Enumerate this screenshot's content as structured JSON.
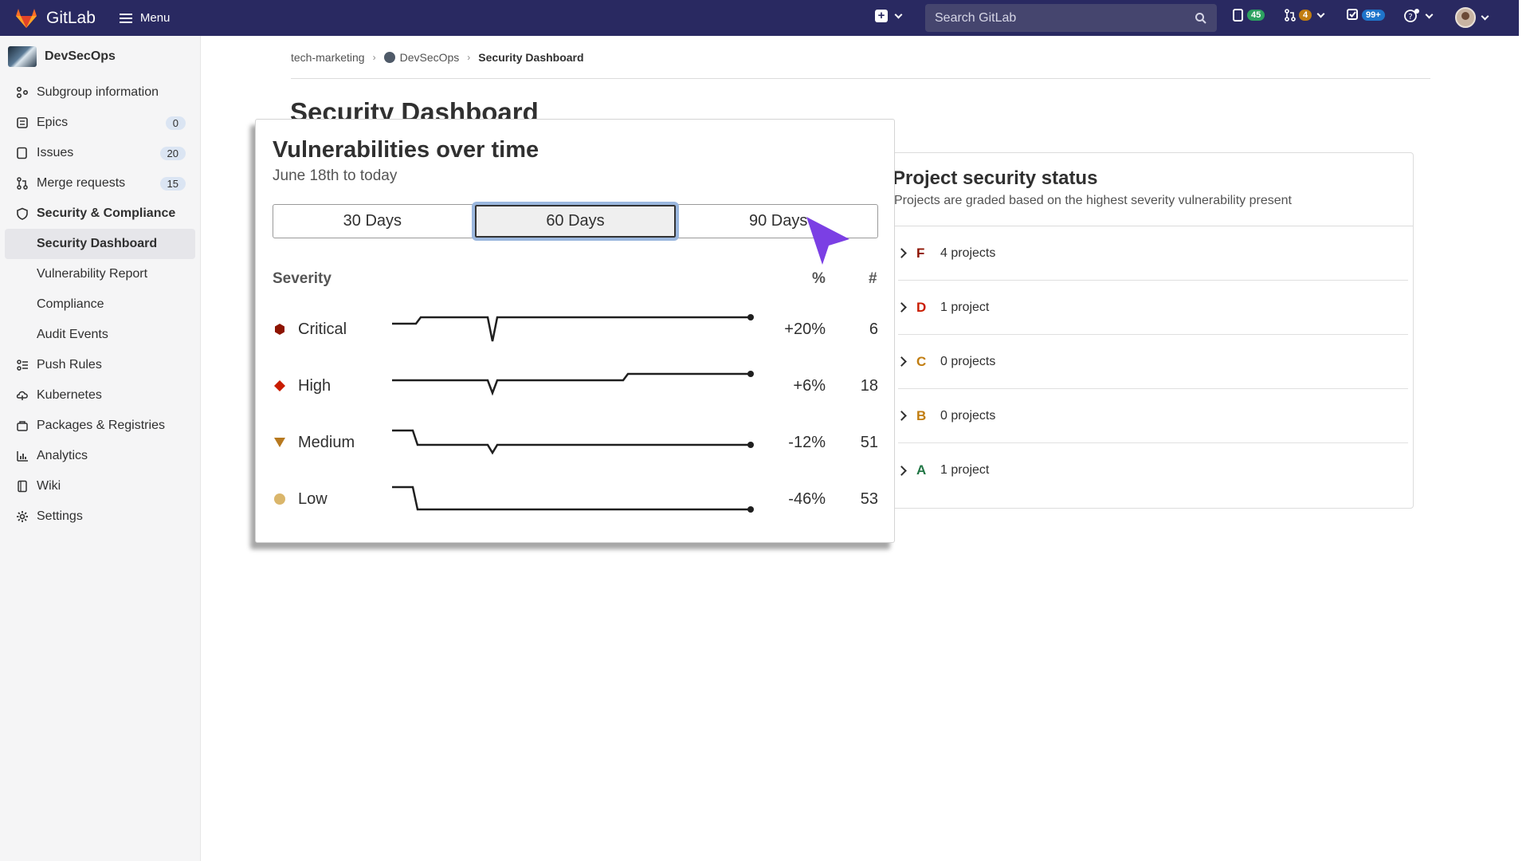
{
  "topbar": {
    "brand": "GitLab",
    "menu_label": "Menu",
    "search_placeholder": "Search GitLab",
    "issues_count": "45",
    "mr_count": "4",
    "todo_count": "99+",
    "colors": {
      "bar": "#292961",
      "issues_badge": "#2da160",
      "mr_badge": "#c17d10",
      "todo_badge": "#1f75cb"
    }
  },
  "sidebar": {
    "group_name": "DevSecOps",
    "items": [
      {
        "label": "Subgroup information",
        "icon": "subgroup-icon"
      },
      {
        "label": "Epics",
        "icon": "epic-icon",
        "count": "0"
      },
      {
        "label": "Issues",
        "icon": "issues-icon",
        "count": "20"
      },
      {
        "label": "Merge requests",
        "icon": "merge-request-icon",
        "count": "15"
      },
      {
        "label": "Security & Compliance",
        "icon": "shield-icon"
      },
      {
        "label": "Push Rules",
        "icon": "push-rules-icon"
      },
      {
        "label": "Kubernetes",
        "icon": "kubernetes-icon"
      },
      {
        "label": "Packages & Registries",
        "icon": "package-icon"
      },
      {
        "label": "Analytics",
        "icon": "chart-icon"
      },
      {
        "label": "Wiki",
        "icon": "book-icon"
      },
      {
        "label": "Settings",
        "icon": "gear-icon"
      }
    ],
    "security_sub": [
      "Security Dashboard",
      "Vulnerability Report",
      "Compliance",
      "Audit Events"
    ]
  },
  "breadcrumb": [
    "tech-marketing",
    "DevSecOps",
    "Security Dashboard"
  ],
  "page_title": "Security Dashboard",
  "project_status": {
    "title": "Project security status",
    "subtitle": "Projects are graded based on the highest severity vulnerability present",
    "grades": [
      {
        "letter": "F",
        "label": "4 projects",
        "color": "#8d1300"
      },
      {
        "letter": "D",
        "label": "1 project",
        "color": "#c91c00"
      },
      {
        "letter": "C",
        "label": "0 projects",
        "color": "#c17d10"
      },
      {
        "letter": "B",
        "label": "0 projects",
        "color": "#c17d10"
      },
      {
        "letter": "A",
        "label": "1 project",
        "color": "#217645"
      }
    ]
  },
  "vulnerabilities": {
    "title": "Vulnerabilities over time",
    "subtitle": "June 18th to today",
    "ranges": [
      "30 Days",
      "60 Days",
      "90 Days"
    ],
    "selected_range": "60 Days",
    "headers": {
      "severity": "Severity",
      "percent": "%",
      "count": "#"
    },
    "rows": [
      {
        "name": "Critical",
        "percent": "+20%",
        "count": "6",
        "color": "#8d1300",
        "shape": "hexagon"
      },
      {
        "name": "High",
        "percent": "+6%",
        "count": "18",
        "color": "#c91c00",
        "shape": "diamond"
      },
      {
        "name": "Medium",
        "percent": "-12%",
        "count": "51",
        "color": "#b7791f",
        "shape": "triangle"
      },
      {
        "name": "Low",
        "percent": "-46%",
        "count": "53",
        "color": "#dab66b",
        "shape": "circle"
      }
    ]
  }
}
